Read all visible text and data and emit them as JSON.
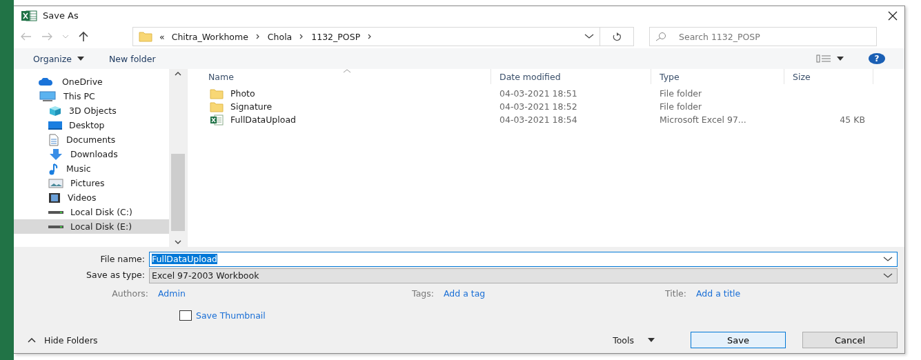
{
  "window": {
    "title": "Save As"
  },
  "address": {
    "overflow": "«",
    "path": [
      "Chitra_Workhome",
      "Chola",
      "1132_POSP"
    ]
  },
  "search": {
    "placeholder": "Search 1132_POSP"
  },
  "toolbar": {
    "organize": "Organize",
    "new_folder": "New folder",
    "help": "?"
  },
  "sidebar": {
    "items": [
      {
        "label": "OneDrive",
        "kind": "cloud",
        "selected": false
      },
      {
        "label": "This PC",
        "kind": "pc",
        "selected": false,
        "children": [
          {
            "label": "3D Objects",
            "kind": "cube",
            "selected": false
          },
          {
            "label": "Desktop",
            "kind": "desktop",
            "selected": false
          },
          {
            "label": "Documents",
            "kind": "doc",
            "selected": false
          },
          {
            "label": "Downloads",
            "kind": "download",
            "selected": false
          },
          {
            "label": "Music",
            "kind": "music",
            "selected": false
          },
          {
            "label": "Pictures",
            "kind": "pictures",
            "selected": false
          },
          {
            "label": "Videos",
            "kind": "video",
            "selected": false
          },
          {
            "label": "Local Disk (C:)",
            "kind": "disk",
            "selected": false
          },
          {
            "label": "Local Disk (E:)",
            "kind": "disk",
            "selected": true
          }
        ]
      }
    ]
  },
  "table": {
    "columns": [
      "Name",
      "Date modified",
      "Type",
      "Size"
    ],
    "rows": [
      {
        "kind": "folder",
        "name": "Photo",
        "date": "04-03-2021 18:51",
        "type": "File folder"
      },
      {
        "kind": "folder",
        "name": "Signature",
        "date": "04-03-2021 18:52",
        "type": "File folder"
      },
      {
        "kind": "excel",
        "name": "FullDataUpload",
        "date": "04-03-2021 18:54",
        "type": "Microsoft Excel 97...",
        "size": "45 KB"
      }
    ]
  },
  "file_name": {
    "label": "File name:",
    "value": "FullDataUpload",
    "selected": true
  },
  "save_type": {
    "label": "Save as type:",
    "value": "Excel 97-2003 Workbook"
  },
  "meta": [
    {
      "label": "Authors:",
      "value": "Admin"
    },
    {
      "label": "Tags:",
      "value": "Add a tag"
    },
    {
      "label": "Title:",
      "value": "Add a title"
    }
  ],
  "thumbnail": {
    "label": "Save Thumbnail",
    "checked": false
  },
  "hide_folders": "Hide Folders",
  "tools": "Tools",
  "buttons": [
    {
      "label": "Save",
      "kind": "primary"
    },
    {
      "label": "Cancel",
      "kind": "secondary"
    }
  ]
}
